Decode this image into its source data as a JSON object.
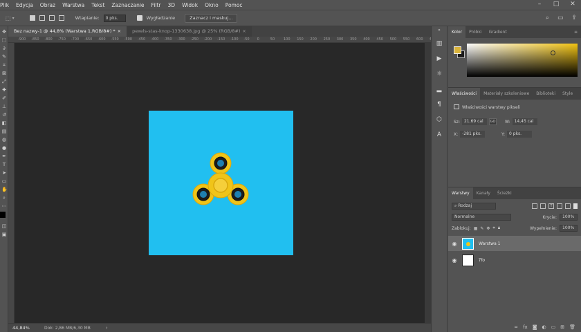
{
  "menu": [
    "Plik",
    "Edycja",
    "Obraz",
    "Warstwa",
    "Tekst",
    "Zaznaczanie",
    "Filtr",
    "3D",
    "Widok",
    "Okno",
    "Pomoc"
  ],
  "options": {
    "feather_label": "Wtapianie:",
    "feather_value": "0 pks.",
    "antialias_label": "Wygładzanie",
    "select_mask_label": "Zaznacz i maskuj..."
  },
  "tabs": [
    {
      "label": "Bez nazwy-1 @ 44,8% (Warstwa 1,RGB/8#) *",
      "active": true
    },
    {
      "label": "pexels-stas-knop-1330638.jpg @ 25% (RGB/8#)",
      "active": false
    }
  ],
  "ruler_ticks": [
    "-900",
    "-850",
    "-800",
    "-750",
    "-700",
    "-650",
    "-600",
    "-550",
    "-500",
    "-450",
    "-400",
    "-350",
    "-300",
    "-250",
    "-200",
    "-150",
    "-100",
    "-50",
    "0",
    "50",
    "100",
    "150",
    "200",
    "250",
    "300",
    "350",
    "400",
    "450",
    "500",
    "550",
    "600",
    "650",
    "700",
    "750",
    "800",
    "850",
    "900",
    "950",
    "1000",
    "1050"
  ],
  "status": {
    "zoom": "44,84%",
    "doc": "Dok: 2,86 MB/6,30 MB"
  },
  "color_panel": {
    "tabs": [
      "Kolor",
      "Próbki",
      "Gradient"
    ],
    "fg_color": "#d9b33a",
    "bg_color": "#1a1a1a",
    "spectrum_hue": "#f2c312"
  },
  "properties_panel": {
    "tabs": [
      "Właściwości",
      "Materiały szkoleniowe",
      "Biblioteki",
      "Style"
    ],
    "title": "Właściwości warstwy pikseli",
    "w_label": "Sz:",
    "w_value": "21,69 cal",
    "h_label": "W:",
    "h_value": "14,45 cal",
    "link_label": "GO",
    "x_label": "X:",
    "x_value": "-281 pks.",
    "y_label": "Y:",
    "y_value": "0 pks."
  },
  "layers_panel": {
    "tabs": [
      "Warstwy",
      "Kanały",
      "Ścieżki"
    ],
    "filter_label": "Rodzaj",
    "blend_mode": "Normalne",
    "opacity_label": "Krycie:",
    "opacity_value": "100%",
    "lock_label": "Zablokuj:",
    "fill_label": "Wypełnienie:",
    "fill_value": "100%",
    "layers": [
      {
        "name": "Warstwa 1",
        "selected": true
      },
      {
        "name": "Tło",
        "selected": false
      }
    ]
  },
  "colors": {
    "canvas_bg": "#282828",
    "doc_fill": "#21bff0",
    "spinner": "#f0c419"
  }
}
